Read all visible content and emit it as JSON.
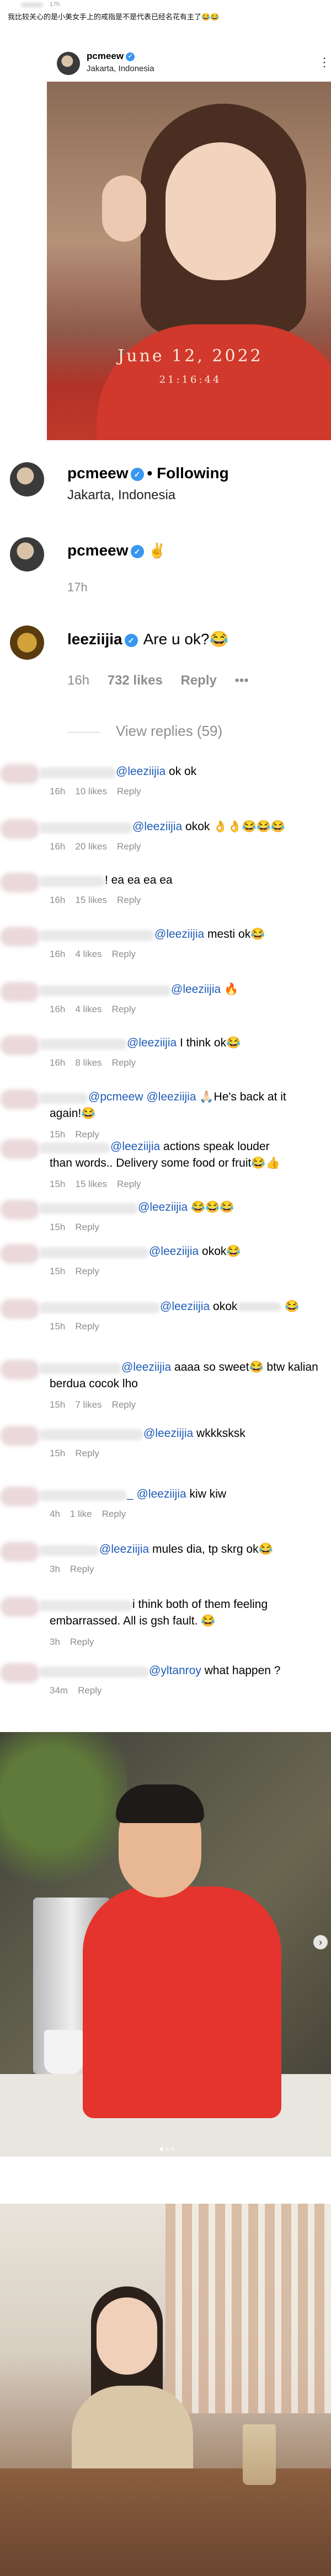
{
  "top": {
    "timestamp": "17h",
    "caption": "我比较关心的是小美女手上的戒指是不是代表已经名花有主了😂😂"
  },
  "post": {
    "username": "pcmeew",
    "location": "Jakarta, Indonesia",
    "more_icon": "⋮",
    "photo_date": "June 12, 2022",
    "photo_time": "21:16:44"
  },
  "profile": {
    "username": "pcmeew",
    "following": "• Following",
    "location": "Jakarta, Indonesia"
  },
  "caption_row": {
    "username": "pcmeew",
    "emoji": "✌️",
    "ago": "17h"
  },
  "top_comment": {
    "username": "leeziijia",
    "text": "Are u ok?😂",
    "ago": "16h",
    "likes": "732 likes",
    "reply": "Reply",
    "more": "•••",
    "view_replies": "View replies (59)"
  },
  "replies": [
    {
      "mention": "@leeziijia",
      "text": " ok ok",
      "ago": "16h",
      "likes": "10 likes",
      "reply": "Reply"
    },
    {
      "mention": "@leeziijia",
      "text": " okok 👌👌😂😂😂",
      "ago": "16h",
      "likes": "20 likes",
      "reply": "Reply"
    },
    {
      "mention": "",
      "text": "! ea ea ea ea",
      "ago": "16h",
      "likes": "15 likes",
      "reply": "Reply"
    },
    {
      "mention": "@leeziijia",
      "text": " mesti ok😂",
      "ago": "16h",
      "likes": "4 likes",
      "reply": "Reply"
    },
    {
      "mention": "@leeziijia",
      "text": " 🔥",
      "ago": "16h",
      "likes": "4 likes",
      "reply": "Reply"
    },
    {
      "mention": "@leeziijia",
      "text": " I think ok😂",
      "ago": "16h",
      "likes": "8 likes",
      "reply": "Reply"
    },
    {
      "mention": "@pcmeew @leeziijia",
      "text": " 🙏🏻He's back at it",
      "text2": "again!😂",
      "ago": "15h",
      "likes": "",
      "reply": "Reply"
    },
    {
      "mention": "@leeziijia",
      "text": " actions speak louder",
      "text2": "than words.. Delivery some food or fruit😂👍",
      "ago": "15h",
      "likes": "15 likes",
      "reply": "Reply"
    },
    {
      "mention": "@leeziijia",
      "text": " 😂😂😂",
      "ago": "15h",
      "likes": "",
      "reply": "Reply"
    },
    {
      "mention": "@leeziijia",
      "text": " okok😂",
      "ago": "15h",
      "likes": "",
      "reply": "Reply"
    },
    {
      "mention": "@leeziijia",
      "text": " okok",
      "text_tail": " 😂",
      "ago": "15h",
      "likes": "",
      "reply": "Reply"
    },
    {
      "mention": "@leeziijia",
      "text": " aaaa so sweet😂 btw kalian",
      "text2": "berdua cocok lho",
      "ago": "15h",
      "likes": "7 likes",
      "reply": "Reply"
    },
    {
      "mention": "@leeziijia",
      "text": " wkkksksk",
      "ago": "15h",
      "likes": "",
      "reply": "Reply"
    },
    {
      "mention": "_ @leeziijia",
      "text": " kiw kiw",
      "ago": "4h",
      "likes": "1 like",
      "reply": "Reply"
    },
    {
      "mention": "@leeziijia",
      "text": " mules dia, tp skrg ok😂",
      "ago": "3h",
      "likes": "",
      "reply": "Reply"
    },
    {
      "mention": "",
      "text": "i think both of them feeling",
      "text2": "embarrassed. All is gsh fault. 😂",
      "ago": "3h",
      "likes": "",
      "reply": "Reply"
    },
    {
      "mention": "@yltanroy",
      "text": " what happen ?",
      "ago": "34m",
      "likes": "",
      "reply": "Reply"
    }
  ],
  "icons": {
    "verified": "✓",
    "carousel_next": "›"
  }
}
